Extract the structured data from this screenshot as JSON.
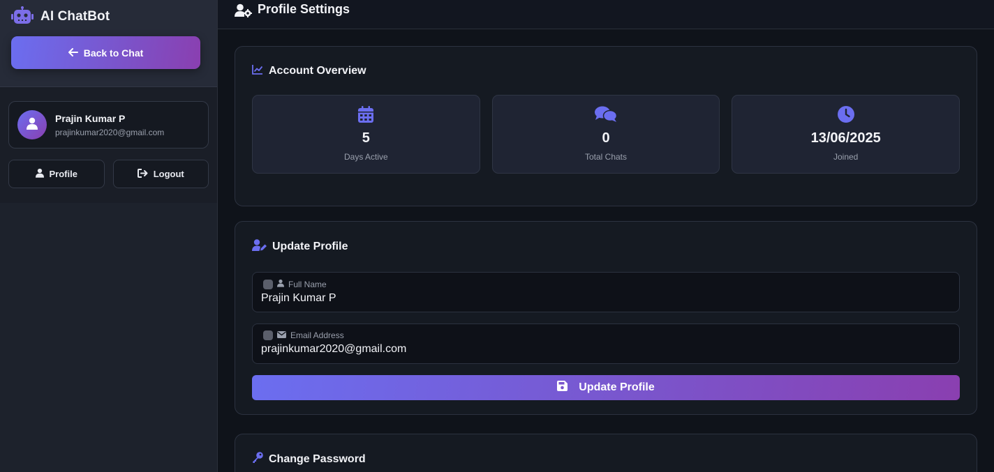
{
  "app": {
    "title": "AI ChatBot",
    "back_button_label": "Back to Chat"
  },
  "user": {
    "name": "Prajin Kumar P",
    "email": "prajinkumar2020@gmail.com"
  },
  "sidebar_actions": {
    "profile_label": "Profile",
    "logout_label": "Logout"
  },
  "header": {
    "title": "Profile Settings"
  },
  "account_overview": {
    "title": "Account Overview",
    "stats": [
      {
        "value": "5",
        "label": "Days Active",
        "icon": "calendar-icon"
      },
      {
        "value": "0",
        "label": "Total Chats",
        "icon": "chat-bubbles-icon"
      },
      {
        "value": "13/06/2025",
        "label": "Joined",
        "icon": "clock-icon"
      }
    ]
  },
  "update_profile": {
    "title": "Update Profile",
    "full_name_label": "Full Name",
    "full_name_value": "Prajin Kumar P",
    "email_label": "Email Address",
    "email_value": "prajinkumar2020@gmail.com",
    "button_label": "Update Profile"
  },
  "change_password": {
    "title": "Change Password"
  },
  "colors": {
    "accent_start": "#6b6ef0",
    "accent_end": "#8a3fb0",
    "icon_accent": "#6b6ef0"
  }
}
